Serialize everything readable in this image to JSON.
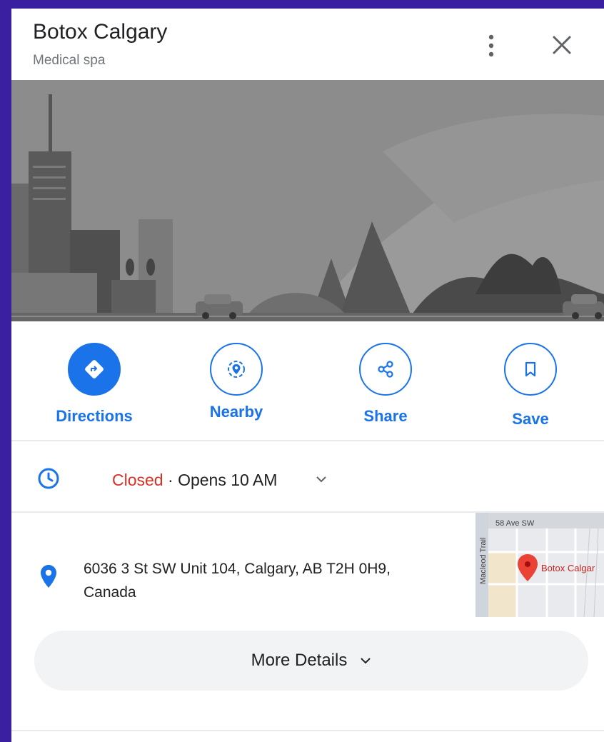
{
  "place": {
    "name": "Botox Calgary",
    "category": "Medical spa"
  },
  "actions": [
    {
      "label": "Directions",
      "icon": "directions-icon"
    },
    {
      "label": "Nearby",
      "icon": "nearby-icon"
    },
    {
      "label": "Share",
      "icon": "share-icon"
    },
    {
      "label": "Save",
      "icon": "bookmark-icon"
    }
  ],
  "hours": {
    "status": "Closed",
    "separator": " · ",
    "next": "Opens 10 AM"
  },
  "address": {
    "line1": "6036 3 St SW Unit 104, Calgary, AB T2H 0H9,",
    "line2": "Canada"
  },
  "map": {
    "street_top": "58 Ave SW",
    "street_side": "Macleod Trail",
    "marker_label": "Botox Calgar"
  },
  "details_button": {
    "label": "More Details"
  },
  "colors": {
    "accent": "#1a73e8",
    "closed": "#d93025",
    "frame": "#3a1fa0"
  }
}
